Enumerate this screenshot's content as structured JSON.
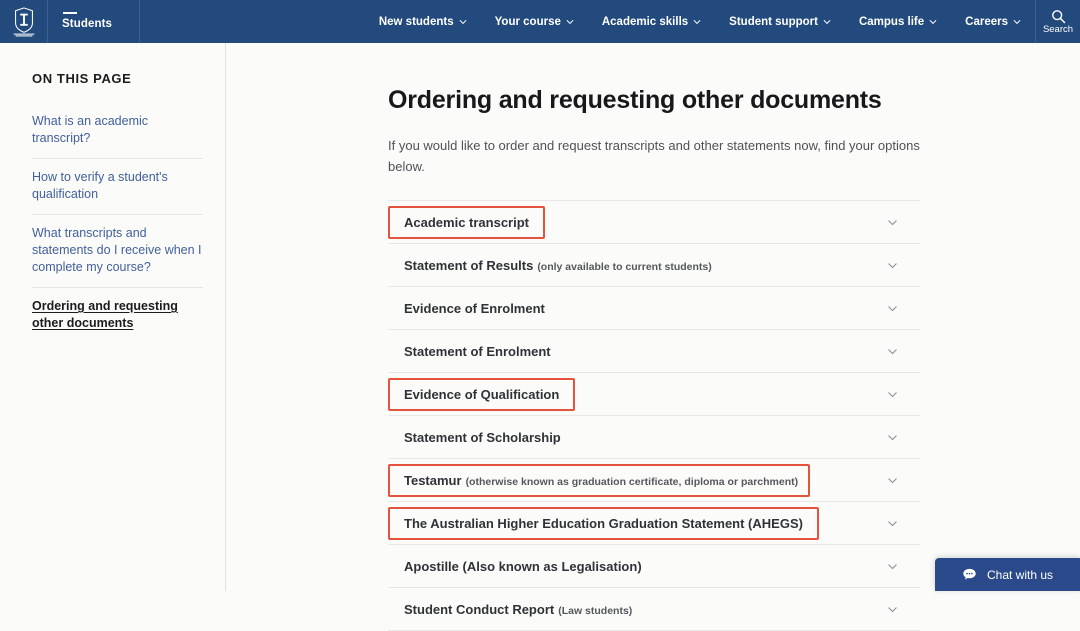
{
  "header": {
    "logo_alt": "University of Melbourne crest",
    "brand_label": "Students",
    "nav_items": [
      {
        "label": "New students"
      },
      {
        "label": "Your course"
      },
      {
        "label": "Academic skills"
      },
      {
        "label": "Student support"
      },
      {
        "label": "Campus life"
      },
      {
        "label": "Careers"
      }
    ],
    "search_label": "Search",
    "colors": {
      "background": "#234a7d",
      "text": "#ffffff"
    }
  },
  "sidebar": {
    "heading": "ON THIS PAGE",
    "items": [
      {
        "label": "What is an academic transcript?",
        "active": false
      },
      {
        "label": "How to verify a student's qualification",
        "active": false
      },
      {
        "label": "What transcripts and statements do I receive when I complete my course?",
        "active": false
      },
      {
        "label": "Ordering and requesting other documents",
        "active": true
      }
    ],
    "colors": {
      "link": "#42609c",
      "active": "#1c1c1c"
    }
  },
  "main": {
    "title": "Ordering and requesting other documents",
    "intro": "If you would like to order and request transcripts and other statements now, find your options below.",
    "accordion": [
      {
        "title": "Academic transcript",
        "note": "",
        "highlighted": true
      },
      {
        "title": "Statement of Results",
        "note": "(only available to current students)",
        "highlighted": false
      },
      {
        "title": "Evidence of Enrolment",
        "note": "",
        "highlighted": false
      },
      {
        "title": "Statement of Enrolment",
        "note": "",
        "highlighted": false
      },
      {
        "title": "Evidence of Qualification",
        "note": "",
        "highlighted": true
      },
      {
        "title": "Statement of Scholarship",
        "note": "",
        "highlighted": false
      },
      {
        "title": "Testamur",
        "note": "(otherwise known as graduation certificate, diploma or parchment)",
        "highlighted": true
      },
      {
        "title": "The Australian Higher Education Graduation Statement (AHEGS)",
        "note": "",
        "highlighted": true
      },
      {
        "title": "Apostille (Also known as Legalisation)",
        "note": "",
        "highlighted": false
      },
      {
        "title": "Student Conduct Report",
        "note": "(Law students)",
        "highlighted": false
      }
    ],
    "highlight_color": "#e5533d"
  },
  "chat": {
    "label": "Chat with us",
    "color": "#2a4a8b"
  }
}
